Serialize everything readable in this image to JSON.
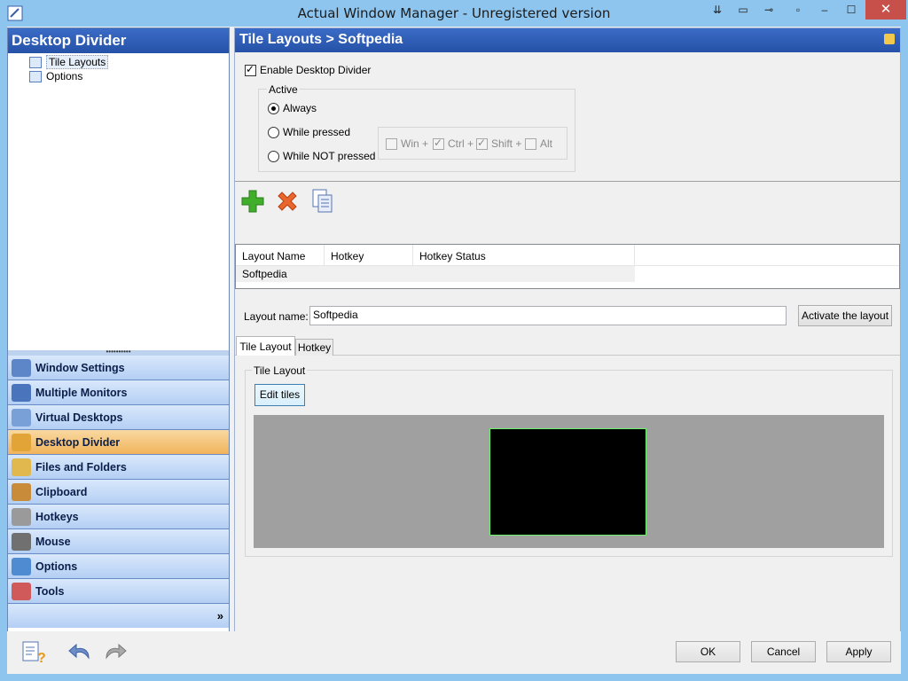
{
  "window": {
    "title": "Actual Window Manager - Unregistered version",
    "close_glyph": "✕",
    "minimize_glyph": "▭",
    "controls": [
      "⇟",
      "▫",
      "⊸",
      "▫"
    ]
  },
  "left": {
    "header": "Desktop Divider",
    "tree": [
      {
        "label": "Tile Layouts",
        "icon": "tile-layouts-icon",
        "selected": true
      },
      {
        "label": "Options",
        "icon": "options-icon",
        "selected": false
      }
    ],
    "splitter_glyph": "••••••••••",
    "nav": [
      {
        "label": "Window Settings",
        "icon": "window-settings-icon",
        "color": "#5d86c8"
      },
      {
        "label": "Multiple Monitors",
        "icon": "multiple-monitors-icon",
        "color": "#4a74bb"
      },
      {
        "label": "Virtual Desktops",
        "icon": "virtual-desktops-icon",
        "color": "#7aa0d8"
      },
      {
        "label": "Desktop Divider",
        "icon": "desktop-divider-icon",
        "color": "#e2a437",
        "active": true
      },
      {
        "label": "Files and Folders",
        "icon": "files-folders-icon",
        "color": "#e0b84e"
      },
      {
        "label": "Clipboard",
        "icon": "clipboard-icon",
        "color": "#c88b3a"
      },
      {
        "label": "Hotkeys",
        "icon": "hotkeys-icon",
        "color": "#9a9a9a"
      },
      {
        "label": "Mouse",
        "icon": "mouse-icon",
        "color": "#707070"
      },
      {
        "label": "Options",
        "icon": "options-icon",
        "color": "#4f8bd0"
      },
      {
        "label": "Tools",
        "icon": "tools-icon",
        "color": "#d05a5a"
      }
    ],
    "more_glyph": "»"
  },
  "right": {
    "header": "Tile Layouts > Softpedia",
    "enable_label": "Enable Desktop Divider",
    "active_group": "Active",
    "radios": [
      "Always",
      "While pressed",
      "While NOT pressed"
    ],
    "modifiers": [
      {
        "label": "Win +",
        "checked": false
      },
      {
        "label": "Ctrl +",
        "checked": true
      },
      {
        "label": "Shift +",
        "checked": true
      },
      {
        "label": "Alt",
        "checked": false
      }
    ],
    "grid": {
      "columns": [
        "Layout Name",
        "Hotkey",
        "Hotkey Status"
      ],
      "rows": [
        [
          "Softpedia",
          "",
          ""
        ]
      ]
    },
    "layout_name_label": "Layout name:",
    "layout_name_value": "Softpedia",
    "activate_button": "Activate the layout",
    "tabs": [
      "Tile Layout",
      "Hotkey"
    ],
    "tile_group": "Tile Layout",
    "edit_tiles_button": "Edit tiles"
  },
  "bottom": {
    "ok": "OK",
    "cancel": "Cancel",
    "apply": "Apply"
  }
}
